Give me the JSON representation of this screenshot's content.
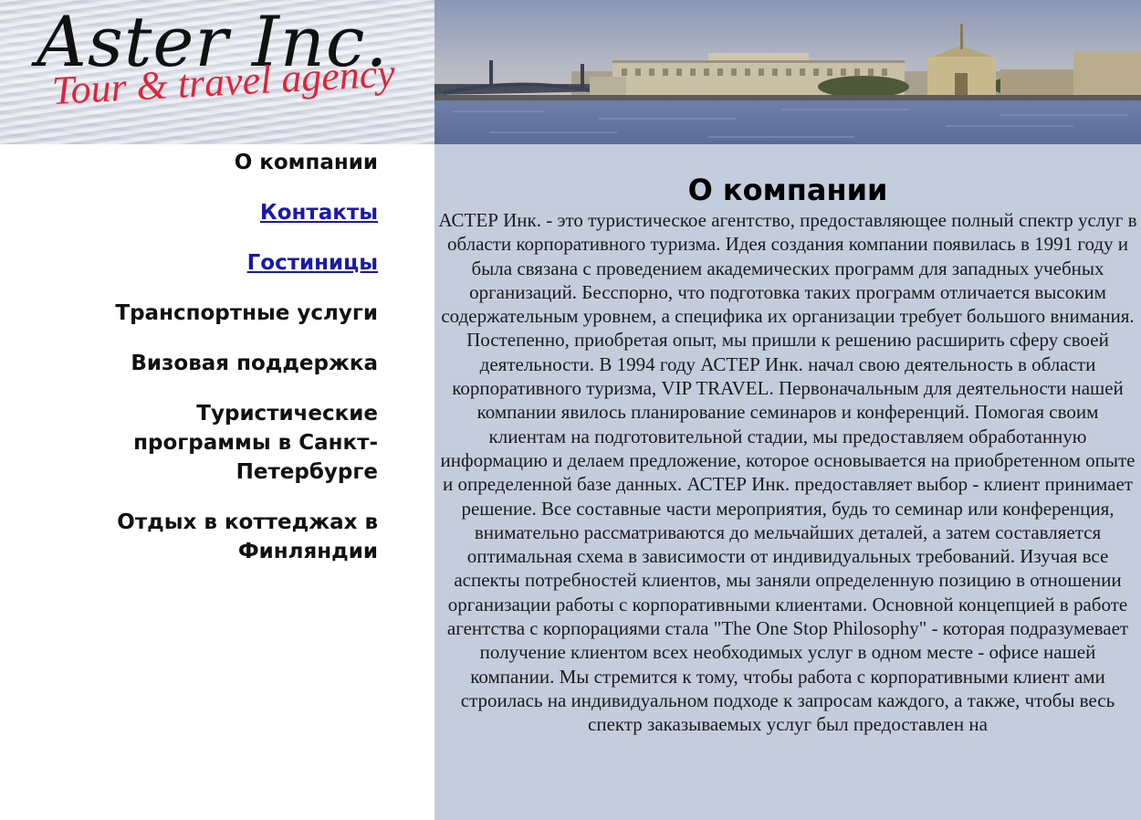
{
  "logo": {
    "title": "Aster Inc.",
    "tagline": "Tour & travel agency"
  },
  "header_photo": {
    "icon": "city-embankment-photo"
  },
  "nav": {
    "items": [
      {
        "label": "О компании",
        "link": false
      },
      {
        "label": "Контакты",
        "link": true
      },
      {
        "label": "Гостиницы",
        "link": true
      },
      {
        "label": "Транспортные услуги",
        "link": false
      },
      {
        "label": "Визовая поддержка",
        "link": false
      },
      {
        "label": "Туристические программы в Санкт-Петербурге",
        "link": false
      },
      {
        "label": "Отдых в коттеджах в Финляндии",
        "link": false
      }
    ]
  },
  "content": {
    "title": "О компании",
    "body": "АСТЕР Инк. - это туристическое агентство, предоставляющее полный спектр услуг в области корпоративного туризма. Идея создания компании появилась в 1991 году и была связана с проведением академических программ для западных учебных организаций. Бесспорно, что подготовка таких программ отличается высоким содержательным уровнем, а специфика их организации требует большого внимания. Постепенно, приобретая опыт, мы пришли к решению расширить сферу своей деятельности. В 1994 году АСТЕР Инк. начал свою деятельность в области корпоративного туризма, VIP TRAVEL. Первоначальным для деятельности нашей компании явилось планирование семинаров и конференций. Помогая своим клиентам на подготовительной стадии, мы предоставляем обработанную информацию и делаем предложение, которое основывается на приобретенном опыте и определенной базе данных. АСТЕР Инк. предоставляет выбор - клиент принимает решение. Все составные части мероприятия, будь то семинар или конференция, внимательно рассматриваются до мельчайших деталей, а затем составляется оптимальная схема в зависимости от индивидуальных требований. Изучая все аспекты потребностей клиентов, мы заняли определенную позицию в отношении организации работы с корпоративными клиентами. Основной концепцией в работе агентства с корпорациями стала \"The One Stop Philosophy\" - которая подразумевает получение клиентом всех необходимых услуг в одном месте - офисе нашей компании. Мы стремится к тому, чтобы работа с корпоративными клиент ами строилась на индивидуальном подходе к запросам каждого, а также, чтобы весь спектр заказываемых услуг был предоставлен на"
  },
  "colors": {
    "content_background": "#c3cddc",
    "link": "#1a1aa6",
    "logo_tagline": "#e0243a"
  }
}
